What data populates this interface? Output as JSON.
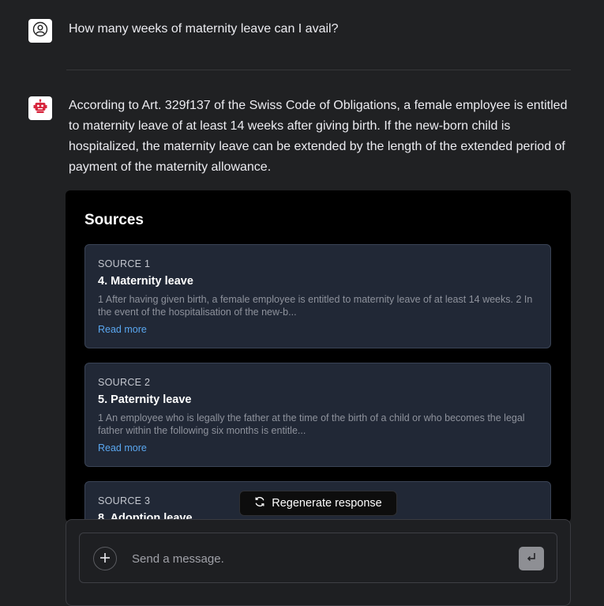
{
  "conversation": {
    "user_message": "How many weeks of maternity leave can I avail?",
    "assistant_message": "According to Art. 329f137 of the Swiss Code of Obligations, a female employee is entitled to maternity leave of at least 14 weeks after giving birth. If the new-born child is hospitalized, the maternity leave can be extended by the length of the extended period of payment of the maternity allowance."
  },
  "sources": {
    "title": "Sources",
    "items": [
      {
        "label": "SOURCE 1",
        "title": "4. Maternity leave",
        "excerpt": "1 After having given birth, a female employee is entitled to maternity leave of at least 14 weeks. 2 In the event of the hospitalisation of the new-b...",
        "link": "Read more"
      },
      {
        "label": "SOURCE 2",
        "title": "5. Paternity leave",
        "excerpt": "1 An employee who is legally the father at the time of the birth of a child or who becomes the legal father within the following six months is entitle...",
        "link": "Read more"
      },
      {
        "label": "SOURCE 3",
        "title": "8. Adoption leave",
        "excerpt": "",
        "link": ""
      }
    ]
  },
  "regenerate": {
    "label": "Regenerate response"
  },
  "composer": {
    "placeholder": "Send a message."
  },
  "icons": {
    "user_avatar": "user-circle-icon",
    "assistant_avatar": "robot-icon",
    "regenerate": "refresh-icon",
    "attach": "plus-icon",
    "send": "enter-return-icon"
  },
  "colors": {
    "background": "#202123",
    "sources_panel": "#000000",
    "card": "#212836",
    "link": "#5aa7f0",
    "robot": "#d7263d"
  }
}
